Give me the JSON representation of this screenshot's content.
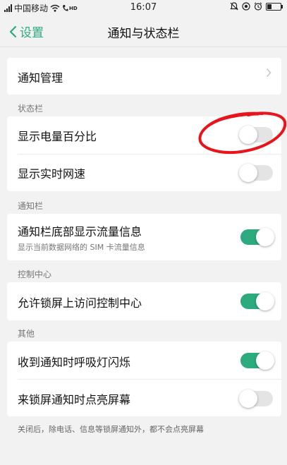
{
  "status_bar": {
    "carrier": "中国移动",
    "hd_label": "HD",
    "time": "16:07"
  },
  "nav": {
    "back_label": "设置",
    "title": "通知与状态栏"
  },
  "notification_management": {
    "label": "通知管理"
  },
  "sections": {
    "status_bar": {
      "header": "状态栏",
      "items": [
        {
          "label": "显示电量百分比",
          "enabled": false
        },
        {
          "label": "显示实时网速",
          "enabled": false
        }
      ]
    },
    "notification_bar": {
      "header": "通知栏",
      "items": [
        {
          "label": "通知栏底部显示流量信息",
          "sublabel": "显示当前数据网络的 SIM 卡流量信息",
          "enabled": true
        }
      ]
    },
    "control_center": {
      "header": "控制中心",
      "items": [
        {
          "label": "允许锁屏上访问控制中心",
          "enabled": true
        }
      ]
    },
    "other": {
      "header": "其他",
      "items": [
        {
          "label": "收到通知时呼吸灯闪烁",
          "enabled": true
        },
        {
          "label": "来锁屏通知时点亮屏幕",
          "enabled": false
        }
      ],
      "footer": "关闭后，除电话、信息等锁屏通知外，都不会点亮屏幕"
    }
  },
  "colors": {
    "accent": "#2bab7e",
    "annotation": "#e8141c",
    "background": "#f2f2f2"
  },
  "icons": [
    "signal-icon",
    "wifi-icon",
    "hd-call-icon",
    "mute-icon",
    "location-icon",
    "alarm-icon",
    "battery-icon",
    "back-chevron-icon",
    "chevron-right-icon"
  ]
}
